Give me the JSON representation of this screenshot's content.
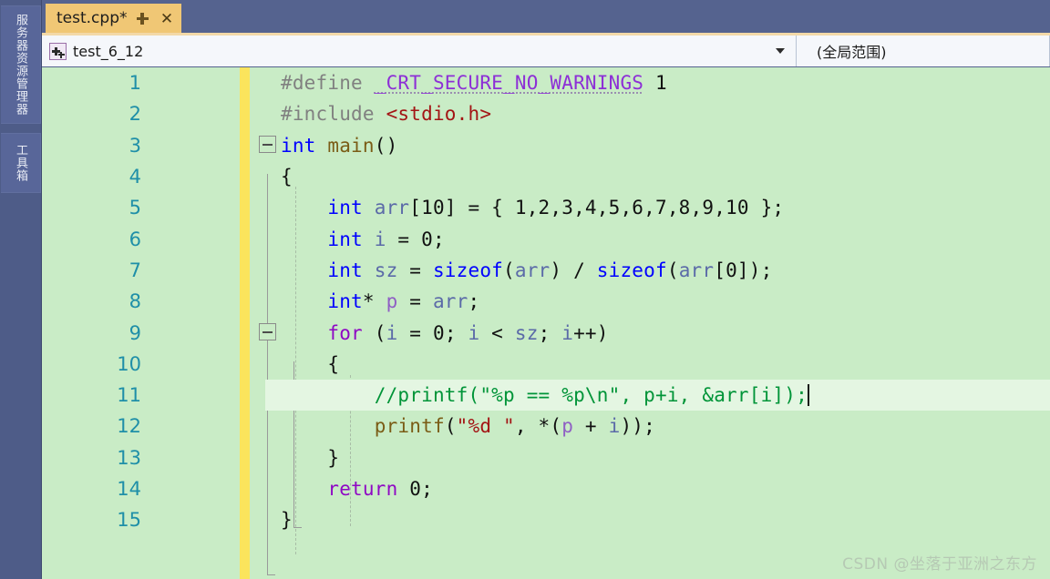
{
  "window": {
    "accent_top": "#55638f",
    "tab_accent": "#f0c775",
    "editor_bg": "#c9ecc6"
  },
  "dock": {
    "items": [
      {
        "label": "服务器资源管理器"
      },
      {
        "label": "工具箱"
      }
    ]
  },
  "tab": {
    "title": "test.cpp*",
    "pin_icon": "pin-icon",
    "close_icon": "close-icon",
    "close_glyph": "✕"
  },
  "navbar": {
    "project_icon": "cpp-project-icon",
    "project": "test_6_12",
    "scope": "(全局范围)",
    "dropdown_icon": "chevron-down-icon"
  },
  "editor": {
    "current_line": 11,
    "lines": [
      {
        "n": "1",
        "tokens": [
          {
            "t": "#define ",
            "c": "k-pre"
          },
          {
            "t": "_CRT_SECURE_NO_WARNINGS",
            "c": "k-macro"
          },
          {
            "t": " ",
            "c": "k-plain"
          },
          {
            "t": "1",
            "c": "k-num"
          }
        ]
      },
      {
        "n": "2",
        "tokens": [
          {
            "t": "#include ",
            "c": "k-pre"
          },
          {
            "t": "<stdio.h>",
            "c": "k-str"
          }
        ]
      },
      {
        "n": "3",
        "tokens": [
          {
            "t": "int",
            "c": "k-key"
          },
          {
            "t": " ",
            "c": "k-plain"
          },
          {
            "t": "main",
            "c": "k-fn"
          },
          {
            "t": "()",
            "c": "k-plain"
          }
        ]
      },
      {
        "n": "4",
        "tokens": [
          {
            "t": "{",
            "c": "k-plain"
          }
        ]
      },
      {
        "n": "5",
        "tokens": [
          {
            "t": "    ",
            "c": "k-plain"
          },
          {
            "t": "int",
            "c": "k-key"
          },
          {
            "t": " ",
            "c": "k-plain"
          },
          {
            "t": "arr",
            "c": "k-var"
          },
          {
            "t": "[",
            "c": "k-plain"
          },
          {
            "t": "10",
            "c": "k-num"
          },
          {
            "t": "] = { ",
            "c": "k-plain"
          },
          {
            "t": "1,2,3,4,5,6,7,8,9,10",
            "c": "k-num"
          },
          {
            "t": " };",
            "c": "k-plain"
          }
        ]
      },
      {
        "n": "6",
        "tokens": [
          {
            "t": "    ",
            "c": "k-plain"
          },
          {
            "t": "int",
            "c": "k-key"
          },
          {
            "t": " ",
            "c": "k-plain"
          },
          {
            "t": "i",
            "c": "k-var"
          },
          {
            "t": " = ",
            "c": "k-plain"
          },
          {
            "t": "0",
            "c": "k-num"
          },
          {
            "t": ";",
            "c": "k-plain"
          }
        ]
      },
      {
        "n": "7",
        "tokens": [
          {
            "t": "    ",
            "c": "k-plain"
          },
          {
            "t": "int",
            "c": "k-key"
          },
          {
            "t": " ",
            "c": "k-plain"
          },
          {
            "t": "sz",
            "c": "k-var"
          },
          {
            "t": " = ",
            "c": "k-plain"
          },
          {
            "t": "sizeof",
            "c": "k-key"
          },
          {
            "t": "(",
            "c": "k-plain"
          },
          {
            "t": "arr",
            "c": "k-var"
          },
          {
            "t": ") / ",
            "c": "k-plain"
          },
          {
            "t": "sizeof",
            "c": "k-key"
          },
          {
            "t": "(",
            "c": "k-plain"
          },
          {
            "t": "arr",
            "c": "k-var"
          },
          {
            "t": "[",
            "c": "k-plain"
          },
          {
            "t": "0",
            "c": "k-num"
          },
          {
            "t": "]);",
            "c": "k-plain"
          }
        ]
      },
      {
        "n": "8",
        "tokens": [
          {
            "t": "    ",
            "c": "k-plain"
          },
          {
            "t": "int",
            "c": "k-key"
          },
          {
            "t": "* ",
            "c": "k-plain"
          },
          {
            "t": "p",
            "c": "k-ptr"
          },
          {
            "t": " = ",
            "c": "k-plain"
          },
          {
            "t": "arr",
            "c": "k-var"
          },
          {
            "t": ";",
            "c": "k-plain"
          }
        ]
      },
      {
        "n": "9",
        "tokens": [
          {
            "t": "    ",
            "c": "k-plain"
          },
          {
            "t": "for",
            "c": "k-ctrl"
          },
          {
            "t": " (",
            "c": "k-plain"
          },
          {
            "t": "i",
            "c": "k-var"
          },
          {
            "t": " = ",
            "c": "k-plain"
          },
          {
            "t": "0",
            "c": "k-num"
          },
          {
            "t": "; ",
            "c": "k-plain"
          },
          {
            "t": "i",
            "c": "k-var"
          },
          {
            "t": " < ",
            "c": "k-plain"
          },
          {
            "t": "sz",
            "c": "k-var"
          },
          {
            "t": "; ",
            "c": "k-plain"
          },
          {
            "t": "i",
            "c": "k-var"
          },
          {
            "t": "++)",
            "c": "k-plain"
          }
        ]
      },
      {
        "n": "10",
        "tokens": [
          {
            "t": "    {",
            "c": "k-plain"
          }
        ]
      },
      {
        "n": "11",
        "tokens": [
          {
            "t": "        ",
            "c": "k-plain"
          },
          {
            "t": "//printf(\"%p == %p\\n\", p+i, &arr[i]);",
            "c": "k-cmt"
          }
        ]
      },
      {
        "n": "12",
        "tokens": [
          {
            "t": "        ",
            "c": "k-plain"
          },
          {
            "t": "printf",
            "c": "k-fn"
          },
          {
            "t": "(",
            "c": "k-plain"
          },
          {
            "t": "\"%d \"",
            "c": "k-str"
          },
          {
            "t": ", *(",
            "c": "k-plain"
          },
          {
            "t": "p",
            "c": "k-ptr"
          },
          {
            "t": " + ",
            "c": "k-plain"
          },
          {
            "t": "i",
            "c": "k-var"
          },
          {
            "t": "));",
            "c": "k-plain"
          }
        ]
      },
      {
        "n": "13",
        "tokens": [
          {
            "t": "    }",
            "c": "k-plain"
          }
        ]
      },
      {
        "n": "14",
        "tokens": [
          {
            "t": "    ",
            "c": "k-plain"
          },
          {
            "t": "return",
            "c": "k-ctrl"
          },
          {
            "t": " ",
            "c": "k-plain"
          },
          {
            "t": "0",
            "c": "k-num"
          },
          {
            "t": ";",
            "c": "k-plain"
          }
        ]
      },
      {
        "n": "15",
        "tokens": [
          {
            "t": "}",
            "c": "k-plain"
          }
        ]
      }
    ]
  },
  "watermark": {
    "text": "CSDN @坐落于亚洲之东方"
  }
}
